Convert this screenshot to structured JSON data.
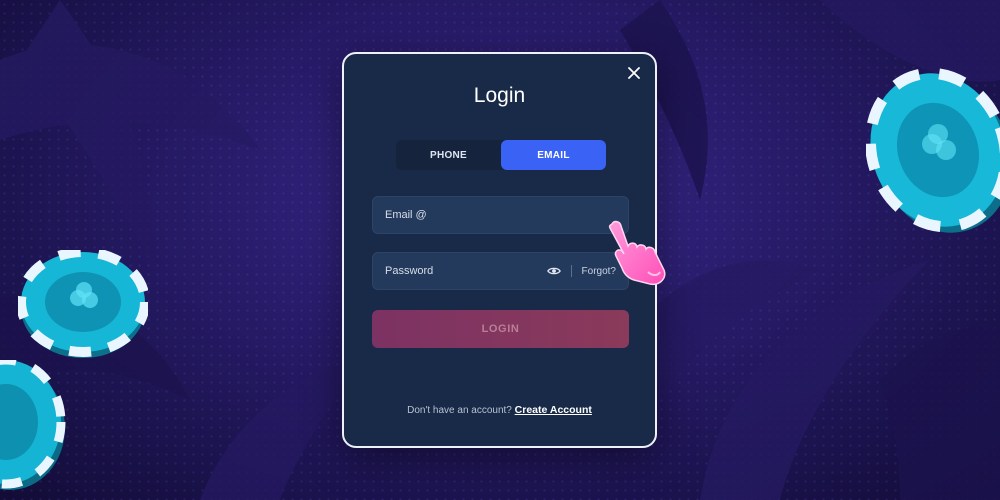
{
  "modal": {
    "title": "Login",
    "tabs": [
      {
        "label": "PHONE",
        "active": false
      },
      {
        "label": "EMAIL",
        "active": true
      }
    ],
    "email_field": {
      "placeholder": "Email @",
      "value": ""
    },
    "password_field": {
      "placeholder": "Password",
      "value": ""
    },
    "forgot_label": "Forgot?",
    "login_label": "LOGIN",
    "footer_text": "Don't have an account?",
    "create_account_label": "Create Account"
  },
  "colors": {
    "accent": "#3a63f5",
    "modal_bg": "#182a47",
    "login_button": "#7c3263",
    "background": "#2a1d6e"
  },
  "icons": {
    "close": "close-icon",
    "eye": "eye-icon",
    "pointer": "pointing-hand-icon"
  }
}
